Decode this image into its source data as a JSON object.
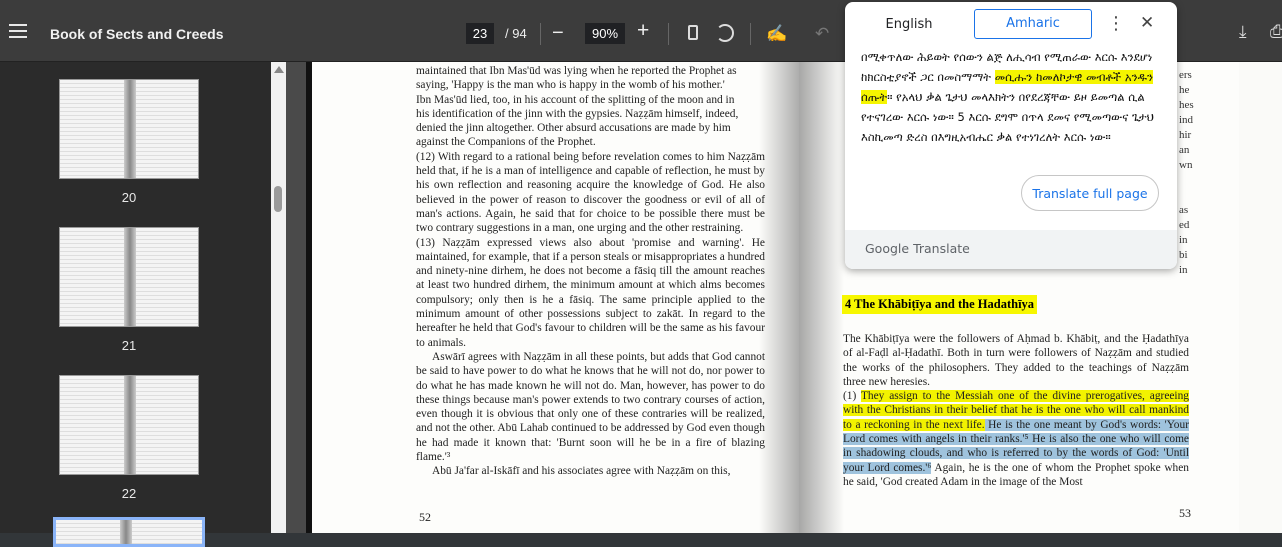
{
  "toolbar": {
    "title": "Book of Sects and Creeds",
    "page_current": "23",
    "page_total": "/ 94",
    "zoom": "90%",
    "zoom_out": "−",
    "zoom_in": "+",
    "annotate": "✍",
    "undo": "↶",
    "download": "⤓",
    "print": "⎙"
  },
  "sidebar": {
    "thumbnails": [
      {
        "label": "20"
      },
      {
        "label": "21"
      },
      {
        "label": "22"
      }
    ]
  },
  "left_page": {
    "lines": [
      "maintained that Ibn Mas'ūd was lying when he reported the Prophet as",
      "saying, 'Happy is the man who is happy in the womb of his mother.'",
      "Ibn Mas'ūd lied, too, in his account of the splitting of the moon and in",
      "his identification of the jinn with the gypsies. Naẓẓām himself, indeed,",
      "denied the jinn altogether. Other absurd accusations are made by him",
      "against the Companions of the Prophet."
    ],
    "para12": "(12) With regard to a rational being before revelation comes to him Naẓẓām held that, if he is a man of intelligence and capable of reflection, he must by his own reflection and reasoning acquire the knowledge of God. He also believed in the power of reason to discover the goodness or evil of all of man's actions. Again, he said that for choice to be possible there must be two contrary suggestions in a man, one urging and the other restraining.",
    "para13": "(13) Naẓẓām expressed views also about 'promise and warning'. He maintained, for example, that if a person steals or misappropriates a hundred and ninety-nine dirhem, he does not become a fāsiq till the amount reaches at least two hundred dirhem, the minimum amount at which alms becomes compulsory; only then is he a fāsiq. The same principle applied to the minimum amount of other possessions subject to zakāt. In regard to the hereafter he held that God's favour to children will be the same as his favour to animals.",
    "para_aswari": "Aswārī agrees with Naẓẓām in all these points, but adds that God cannot be said to have power to do what he knows that he will not do, nor power to do what he has made known he will not do. Man, however, has power to do these things because man's power extends to two contrary courses of action, even though it is obvious that only one of these contraries will be realized, and not the other. Abū Lahab continued to be addressed by God even though he had made it known that: 'Burnt soon will he be in a fire of blazing flame.'³",
    "para_iskafi": "Abū Ja'far al-Iskāfī and his associates agree with Naẓẓām on this,",
    "page_number": "52"
  },
  "right_page": {
    "section_heading": "4 The Khābiṭīya and the Hadathīya",
    "intro": "The Khābiṭīya were the followers of Aḥmad b. Khābiṭ, and the Ḥadathīya of al-Faḍl al-Ḥadathī. Both in turn were followers of Naẓẓām and studied the works of the philosophers. They added to the teachings of Naẓẓām three new heresies.",
    "heresy_prefix": "(1) ",
    "heresy_hl_yellow": "They assign to the Messiah one of the divine prerogatives, agreeing with the Christians in their belief that he is the one who will call mankind to a reckoning in the next life.",
    "heresy_hl_blue": " He is the one meant by God's words: 'Your Lord comes with angels in their ranks.'⁵ He is also the one who will come in shadowing clouds, and who is referred to by the words of God: 'Until your Lord comes.'⁶",
    "heresy_rest": " Again, he is the one of whom the Prophet spoke when he said, 'God created Adam in the image of the Most",
    "page_number": "53",
    "edge_fragments": [
      "ers",
      "he",
      "hes",
      "ind",
      "hir",
      "an",
      "wn",
      "",
      "",
      "as",
      "ed",
      "in",
      "bi",
      "in"
    ]
  },
  "translate_popup": {
    "tab_source": "English",
    "tab_target": "Amharic",
    "more": "⋮",
    "close": "✕",
    "text_before": "በሚቀጥለው ሕይወት የሰውን ልጅ ለሒሳብ የሚጠራው እርሱ እንደሆነ ከክርስቲያኖች ጋር በመስማማት ",
    "text_highlight": "መሲሑን ከመለኮታዊ መብቶች አንዱን ሰጡት",
    "text_after": "። የአላህ ቃል ጌታህ መላእክትን በየደረጃቸው ይዞ ይመጣል ሲል የተናገረው እርሱ ነው። 5 እርሱ ደግሞ በጥላ ደመና የሚመጣውና ጌታህ እስኪመጣ ድረስ በእግዚአብሔር ቃል የተነገረለት እርሱ ነው።",
    "button": "Translate full page",
    "footer_brand": "Google",
    "footer_product": "Translate"
  },
  "colors": {
    "toolbar_bg": "#3c3c3c",
    "sidebar_bg": "#2b2b2b",
    "highlight_yellow": "#f2f200",
    "highlight_blue": "#9fc3dd",
    "accent": "#1a73e8"
  }
}
